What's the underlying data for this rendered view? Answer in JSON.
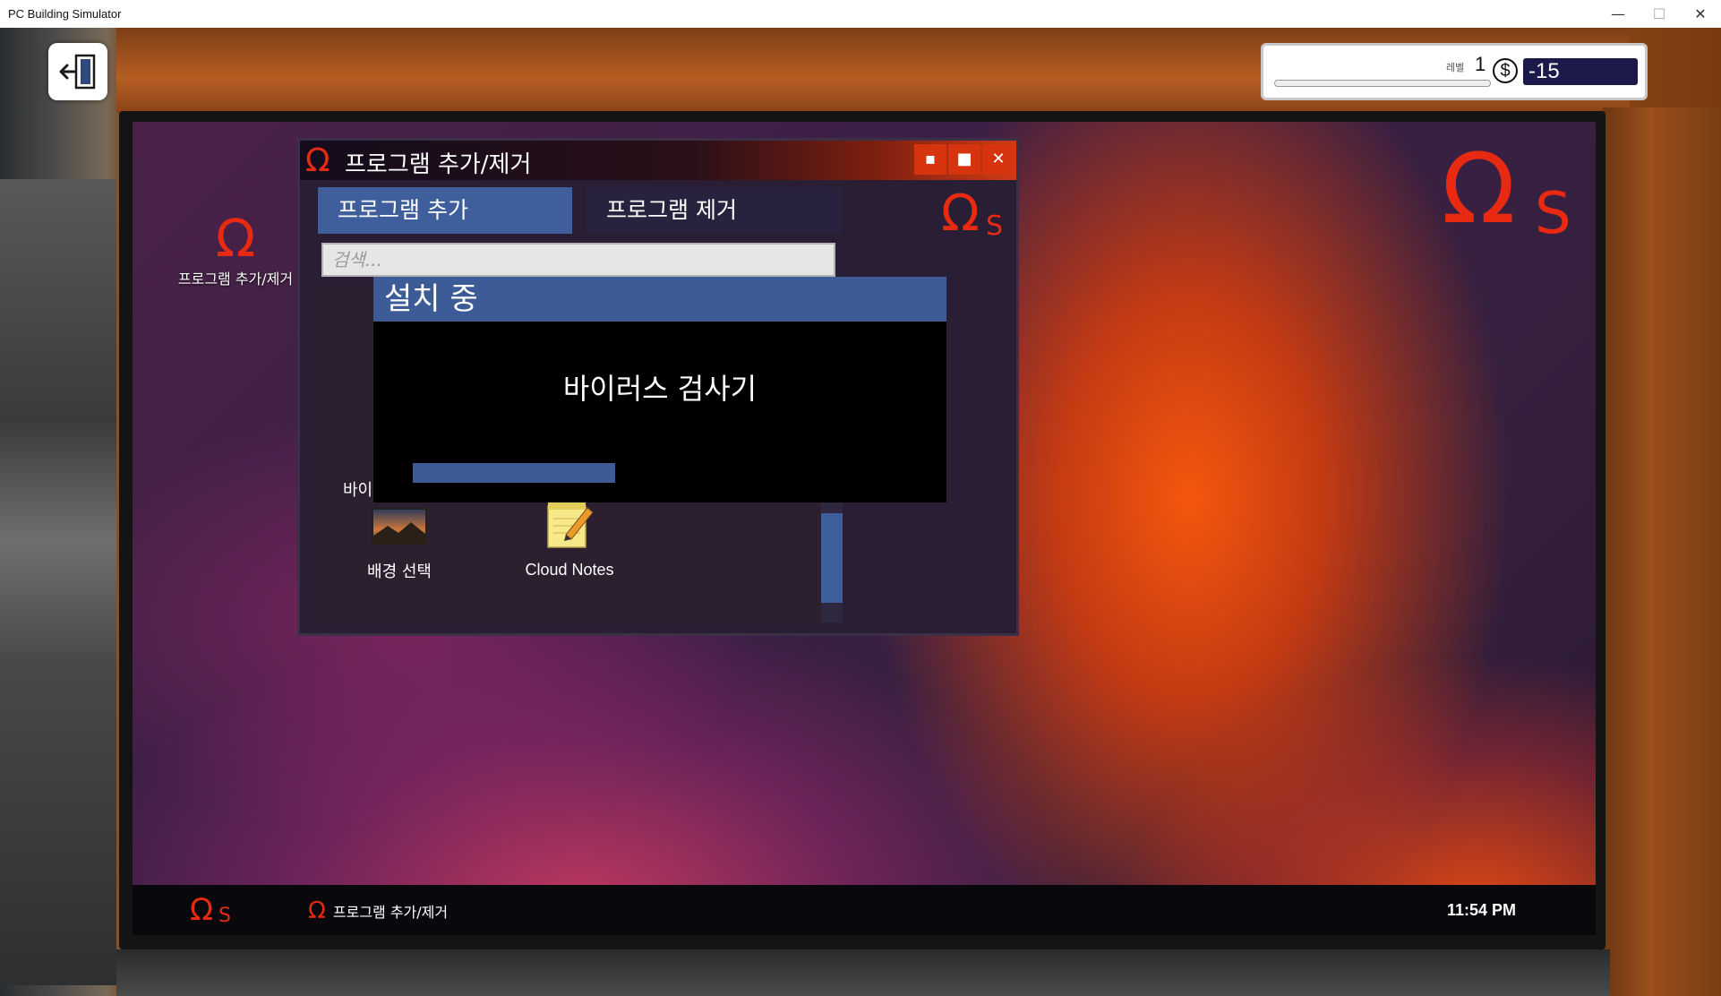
{
  "host_window": {
    "title": "PC Building Simulator",
    "minimize_glyph": "—",
    "maximize_glyph": "☐",
    "close_glyph": "✕"
  },
  "hud": {
    "level_label": "레벨",
    "level_value": "1",
    "xp_progress": 0.0,
    "currency_symbol": "$",
    "money": "-15"
  },
  "exit_button": {
    "icon": "exit-door-icon"
  },
  "desktop": {
    "icon_label": "프로그램 추가/제거",
    "logo_omega": "Ω",
    "logo_s": "S"
  },
  "app_window": {
    "title": "프로그램 추가/제거",
    "minimize": "▪",
    "maximize": "■",
    "close": "✕",
    "tab_add": "프로그램 추가",
    "tab_remove": "프로그램 제거",
    "search_placeholder": "검색...",
    "partial_item_label": "바이",
    "programs": [
      {
        "label": "배경 선택",
        "icon": "wallpaper-icon"
      },
      {
        "label": "Cloud Notes",
        "icon": "notepad-icon"
      }
    ],
    "scroll_position": 0.7
  },
  "install_dialog": {
    "header": "설치 중",
    "program_name": "바이러스 검사기",
    "progress": 0.41
  },
  "taskbar": {
    "active_app": "프로그램 추가/제거",
    "clock": "11:54 PM"
  },
  "colors": {
    "accent_red": "#e82a12",
    "accent_blue": "#3d5b96",
    "money_bg": "#1c1a4a"
  }
}
